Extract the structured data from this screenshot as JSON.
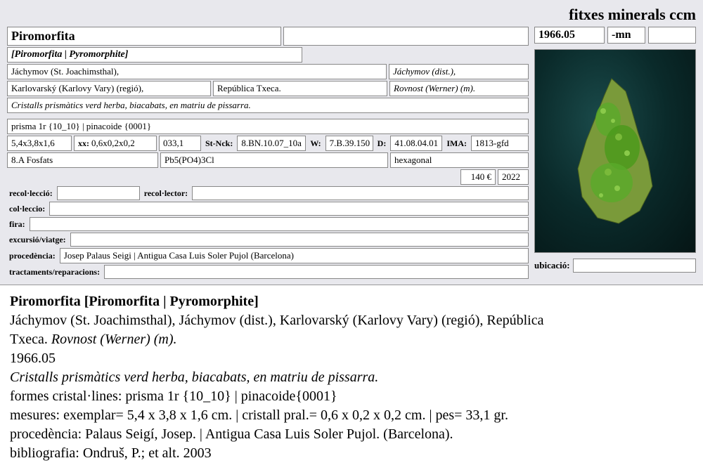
{
  "header": {
    "title": "fitxes minerals ccm"
  },
  "id": {
    "num": "1966.05",
    "suffix": "-mn",
    "extra": ""
  },
  "name": "Piromorfita",
  "synonyms": "[Piromorfita | Pyromorphite]",
  "loc": {
    "town": "Jáchymov (St. Joachimsthal),",
    "dist": "Jáchymov (dist.),",
    "region": "Karlovarský (Karlovy Vary) (regió),",
    "country": "República Txeca.",
    "mine": "Rovnost (Werner) (m)."
  },
  "description": "Cristalls prismàtics verd herba, biacabats, en matriu de pissarra.",
  "crystal_forms": "prisma 1r {10_10} | pinacoide {0001}",
  "dims": {
    "specimen": "5,4x3,8x1,6",
    "xx_label": "xx:",
    "xx": "0,6x0,2x0,2",
    "weight": "033,1",
    "stnck_label": "St-Nck:",
    "stnck": "8.BN.10.07_10a",
    "w_label": "W:",
    "w": "7.B.39.150",
    "d_label": "D:",
    "d": "41.08.04.01",
    "ima_label": "IMA:",
    "ima": "1813-gfd"
  },
  "class": {
    "group": "8.A Fosfats",
    "formula": "Pb5(PO4)3Cl",
    "system": "hexagonal"
  },
  "price": {
    "value": "140 €",
    "year": "2022"
  },
  "fields": {
    "recolleccio_label": "recol·lecció:",
    "recolleccio": "",
    "recollector_label": "recol·lector:",
    "recollector": "",
    "colleccio_label": "col·leccio:",
    "colleccio": "",
    "fira_label": "fira:",
    "fira": "",
    "excursio_label": "excursió/viatge:",
    "excursio": "",
    "procedencia_label": "procedència:",
    "procedencia": "Josep Palaus Seigi | Antigua Casa Luis Soler Pujol (Barcelona)",
    "tractaments_label": "tractaments/reparacions:",
    "tractaments": "",
    "ubicacio_label": "ubicació:",
    "ubicacio": ""
  },
  "summary": {
    "title": "Piromorfita [Piromorfita | Pyromorphite]",
    "loc_line1": "Jáchymov (St. Joachimsthal), Jáchymov (dist.), Karlovarský (Karlovy Vary) (regió), República",
    "loc_line2a": "Txeca. ",
    "loc_line2b": "Rovnost (Werner) (m).",
    "id": "1966.05",
    "desc": "Cristalls prismàtics verd herba, biacabats, en matriu de pissarra.",
    "forms": "formes cristal·lines: prisma 1r {10_10} | pinacoide{0001}",
    "mesures": "mesures: exemplar= 5,4 x 3,8 x 1,6 cm. | cristall pral.= 0,6 x 0,2 x 0,2 cm. | pes= 33,1 gr.",
    "proc": "procedència:  Palaus Seigí, Josep. | Antigua Casa Luis Soler Pujol. (Barcelona).",
    "biblio": "bibliografia: Ondruš, P.; et alt. 2003"
  }
}
